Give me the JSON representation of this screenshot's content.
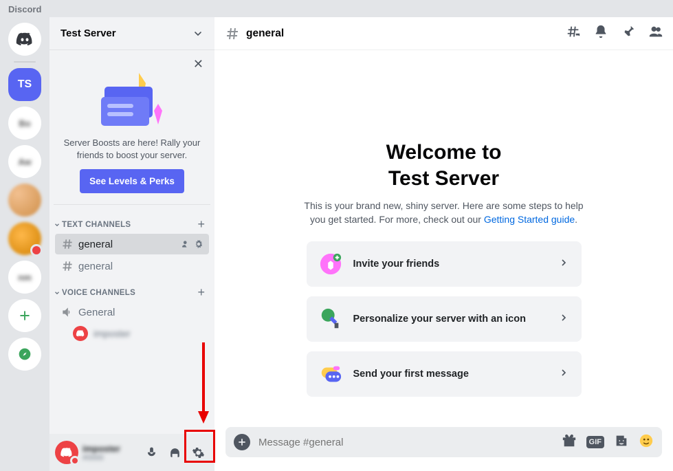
{
  "app": {
    "title": "Discord"
  },
  "servers": {
    "home_icon": "discord-icon",
    "active": {
      "initials": "TS"
    },
    "add_tooltip": "Add a Server",
    "explore_tooltip": "Explore"
  },
  "server_header": {
    "name": "Test Server"
  },
  "boost": {
    "line1": "Server Boosts are here! Rally your",
    "line2": "friends to boost your server.",
    "button": "See Levels & Perks"
  },
  "categories": [
    {
      "label": "TEXT CHANNELS",
      "channels": [
        {
          "name": "general",
          "selected": true
        },
        {
          "name": "general",
          "selected": false
        }
      ]
    },
    {
      "label": "VOICE CHANNELS",
      "channels": [
        {
          "name": "General",
          "type": "voice",
          "users": [
            {
              "name": "imposter"
            }
          ]
        }
      ]
    }
  ],
  "userbar": {
    "username": "imposter",
    "tag": "#0000"
  },
  "channel_header": {
    "name": "general"
  },
  "welcome": {
    "title_l1": "Welcome to",
    "title_l2": "Test Server",
    "desc_a": "This is your brand new, shiny server. Here are some steps to help",
    "desc_b": "you get started. For more, check out our ",
    "link": "Getting Started guide",
    "cards": [
      {
        "label": "Invite your friends",
        "icon": "invite"
      },
      {
        "label": "Personalize your server with an icon",
        "icon": "personalize"
      },
      {
        "label": "Send your first message",
        "icon": "message"
      }
    ]
  },
  "composer": {
    "placeholder": "Message #general"
  }
}
